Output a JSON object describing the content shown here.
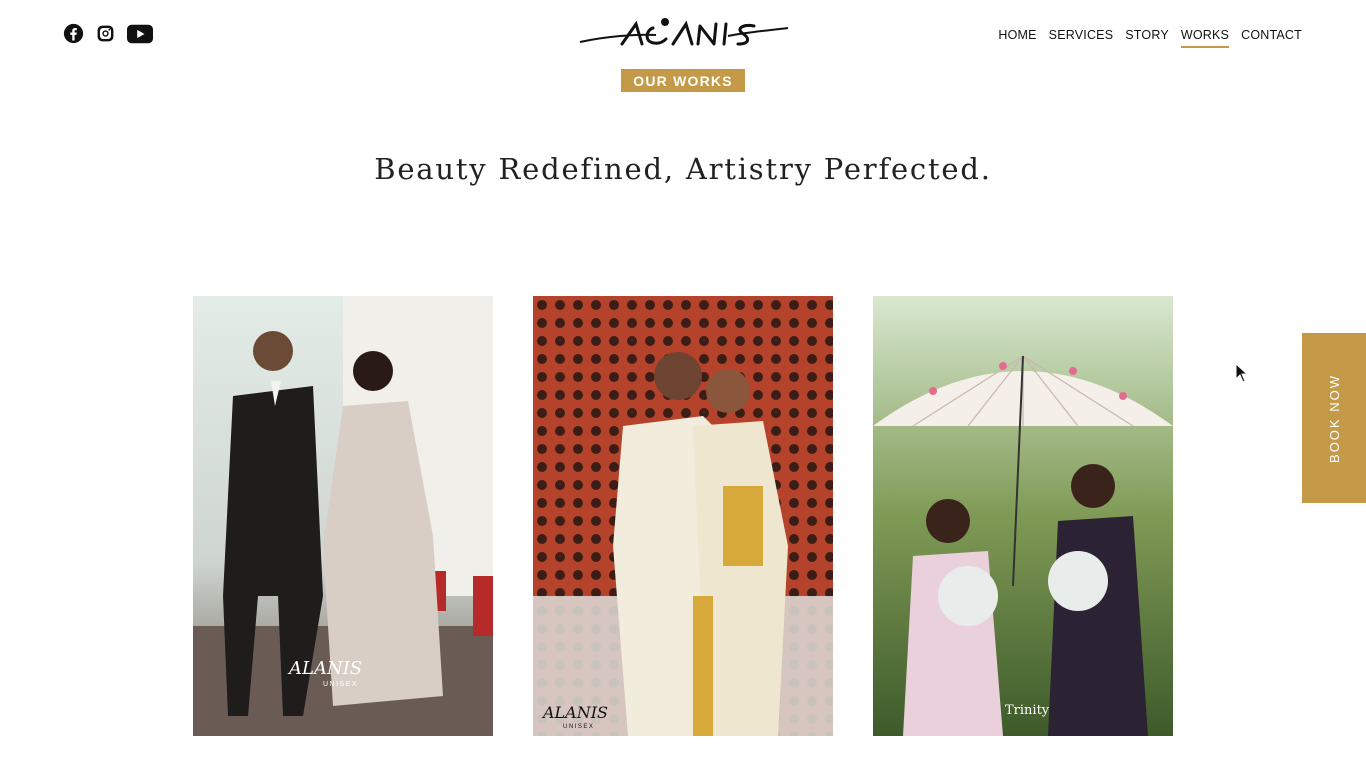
{
  "brand": {
    "logo_text": "ALANIS",
    "accent_color": "#c49a49"
  },
  "social": [
    {
      "name": "facebook",
      "icon": "facebook-icon"
    },
    {
      "name": "instagram",
      "icon": "instagram-icon"
    },
    {
      "name": "youtube",
      "icon": "youtube-icon"
    }
  ],
  "nav": {
    "items": [
      "HOME",
      "SERVICES",
      "STORY",
      "WORKS",
      "CONTACT"
    ],
    "active": "WORKS"
  },
  "section": {
    "badge": "OUR WORKS",
    "headline": "Beauty Redefined, Artistry Perfected."
  },
  "gallery": {
    "photos": [
      {
        "alt": "Couple in tuxedo and saree walking",
        "watermark": "ALANIS",
        "watermark_sub": "UNISEX"
      },
      {
        "alt": "Couple in traditional Kerala attire embracing",
        "watermark": "ALANIS",
        "watermark_sub": "UNISEX"
      },
      {
        "alt": "Couple under a floral umbrella",
        "watermark": "Trinity",
        "watermark_sub": ""
      }
    ]
  },
  "cta": {
    "book_label": "BOOK NOW"
  }
}
